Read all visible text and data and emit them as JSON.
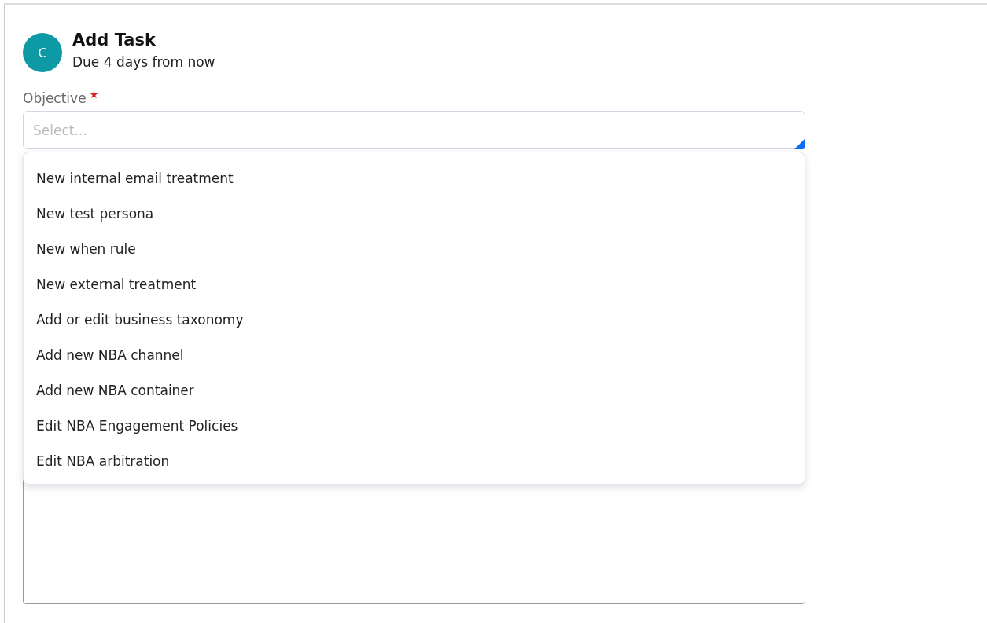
{
  "header": {
    "avatar": "C",
    "title": "Add Task",
    "subtitle": "Due 4 days from now"
  },
  "objective": {
    "label": "Objective",
    "required": true,
    "placeholder": "Select...",
    "expanded": true,
    "options": [
      {
        "label": "New internal email treatment"
      },
      {
        "label": "New test persona"
      },
      {
        "label": "New when rule"
      },
      {
        "label": "New external treatment"
      },
      {
        "label": "Add or edit business taxonomy"
      },
      {
        "label": "Add new NBA channel"
      },
      {
        "label": "Add new NBA container"
      },
      {
        "label": "Edit NBA Engagement Policies"
      },
      {
        "label": "Edit NBA arbitration"
      }
    ]
  }
}
